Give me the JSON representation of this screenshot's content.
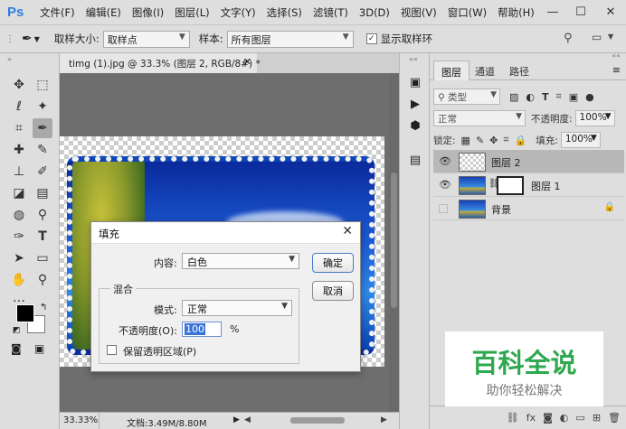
{
  "app": {
    "logo": "Ps"
  },
  "menu": [
    "文件(F)",
    "编辑(E)",
    "图像(I)",
    "图层(L)",
    "文字(Y)",
    "选择(S)",
    "滤镜(T)",
    "3D(D)",
    "视图(V)",
    "窗口(W)",
    "帮助(H)"
  ],
  "window_controls": {
    "minimize": "—",
    "maximize": "☐",
    "close": "✕"
  },
  "options": {
    "sample_size_label": "取样大小:",
    "sample_size_value": "取样点",
    "sample_label": "样本:",
    "sample_value": "所有图层",
    "show_ring_label": "显示取样环",
    "show_ring_checked": true
  },
  "document": {
    "tab_title": "timg (1).jpg @ 33.3% (图层 2, RGB/8#) *",
    "zoom": "33.33%",
    "doc_info": "文档:3.49M/8.80M"
  },
  "panel": {
    "tabs": [
      "图层",
      "通道",
      "路径"
    ],
    "active_tab": "图层",
    "filter_label": "类型",
    "blend_mode": "正常",
    "opacity_label": "不透明度:",
    "opacity_value": "100%",
    "lock_label": "锁定:",
    "fill_label": "填充:",
    "fill_value": "100%",
    "layers": [
      {
        "name": "图层 2",
        "visible": true,
        "selected": true,
        "type": "transparent"
      },
      {
        "name": "图层 1",
        "visible": true,
        "selected": false,
        "type": "masked"
      },
      {
        "name": "背景",
        "visible": false,
        "selected": false,
        "type": "background",
        "locked": true
      }
    ]
  },
  "dialog": {
    "title": "填充",
    "content_label": "内容:",
    "content_value": "白色",
    "ok_label": "确定",
    "cancel_label": "取消",
    "blend_group": "混合",
    "mode_label": "模式:",
    "mode_value": "正常",
    "opacity_label": "不透明度(O):",
    "opacity_value": "100",
    "percent": "%",
    "preserve_label": "保留透明区域(P)",
    "preserve_checked": false
  },
  "watermark": {
    "title": "百科全说",
    "subtitle": "助你轻松解决"
  }
}
